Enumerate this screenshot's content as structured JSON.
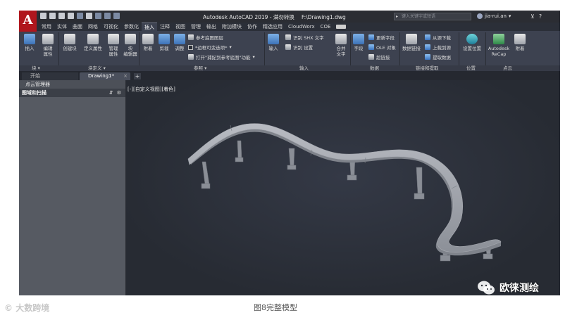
{
  "titlebar": {
    "app_letter": "A",
    "title": "Autodesk AutoCAD 2019 - 满勿转换",
    "file": "F:\\Drawing1.dwg",
    "search_placeholder": "键入关键字或短语",
    "user": "jia-rui.an"
  },
  "ribbon_tabs": [
    "常用",
    "实体",
    "曲面",
    "网格",
    "可视化",
    "参数化",
    "插入",
    "注释",
    "视图",
    "管理",
    "输出",
    "附加模块",
    "协作",
    "精选应用",
    "CloudWorx",
    "COE"
  ],
  "active_tab": "插入",
  "ribbon": {
    "insert": "插入",
    "edit_attr": "编辑\n属性",
    "create_block": "创建块",
    "define_attr": "定义属性",
    "manage_attr": "管理\n属性",
    "block_editor": "块\n编辑器",
    "attach": "附着",
    "clip": "剪裁",
    "adjust": "调整",
    "underlay_layers": "参考底图图层",
    "frame_vary": "*边框可变选项*",
    "snap_underlay": "打开\"捕捉到参考底图\"功能",
    "import": "输入",
    "recognize_shx": "识别 SHX 文字",
    "recognize_settings": "识别 设置",
    "combine_text": "合并\n文字",
    "field": "字段",
    "update_fields": "更新字段",
    "ole_object": "OLE 对象",
    "hyperlink": "超链接",
    "data_link": "数据链接",
    "download_from_source": "从源下载",
    "upload_to_source": "上载到源",
    "extract_data": "提取数据",
    "set_location": "设置位置",
    "recap": "Autodesk\nReCap",
    "attach2": "附着"
  },
  "panel_labels": {
    "block": "块 ▾",
    "block_def": "块定义 ▾",
    "reference": "参照 ▾",
    "import": "输入",
    "data": "数据",
    "link_extract": "链接和提取",
    "location": "位置",
    "point_cloud": "点云"
  },
  "file_tabs": {
    "start": "开始",
    "drawing": "Drawing1*"
  },
  "palette": {
    "title": "点云管理器",
    "row": "图域和扫描"
  },
  "viewport": {
    "label": "[-][自定义视图][着色]"
  },
  "caption": "图8完整模型",
  "watermark_left": "大数跨境",
  "watermark_right": "欧徕测绘",
  "colors": {
    "logo_red": "#b0161d",
    "ribbon_bg": "#3d4250",
    "viewport_bg": "#2b2f38",
    "model_gray": "#9ea1a8"
  }
}
